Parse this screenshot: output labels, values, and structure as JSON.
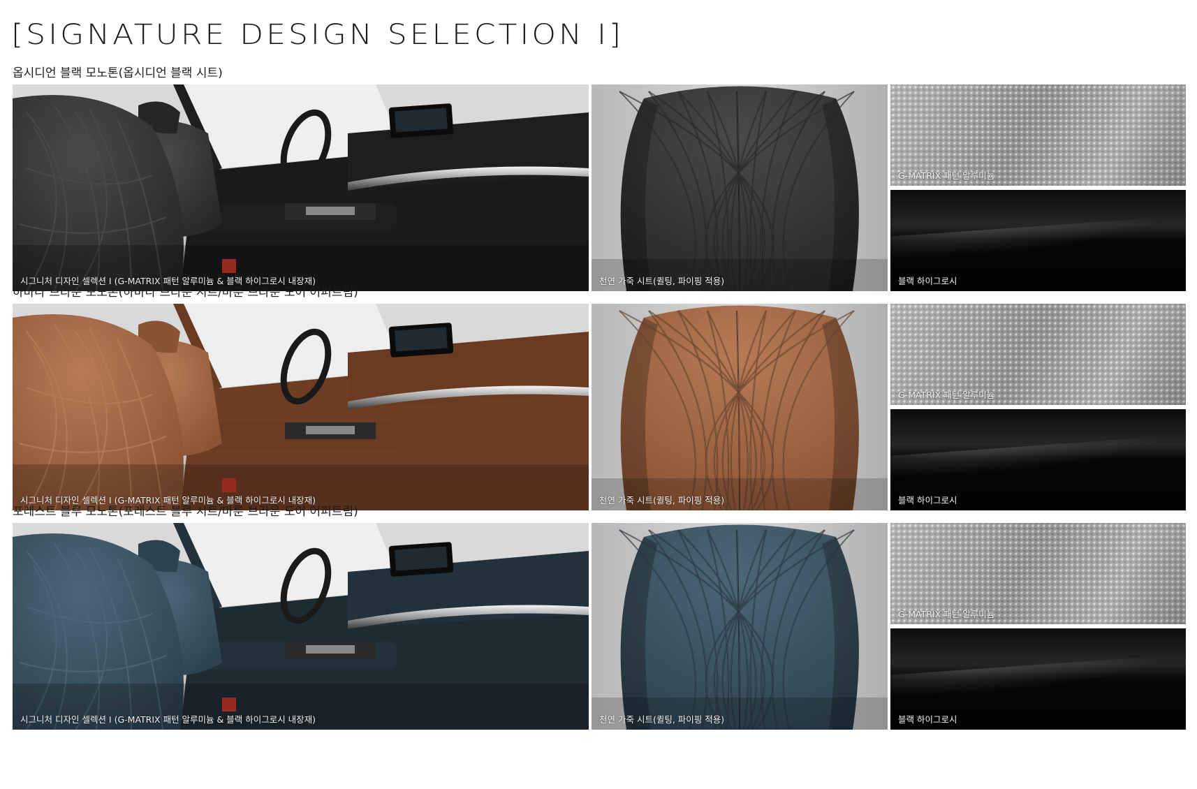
{
  "page_title": "[SIGNATURE DESIGN SELECTION I]",
  "captions": {
    "interior": "시그니처 디자인 셀렉션 I (G-MATRIX 패턴 알루미늄 & 블랙 하이그로시 내장재)",
    "seat": "천연 가죽 시트(퀼팅, 파이핑 적용)",
    "aluminum": "G-MATRIX 패턴 알루미늄",
    "gloss": "블랙 하이그로시"
  },
  "sections": [
    {
      "title": "옵시디언 블랙 모노톤(옵시디언 블랙 시트)",
      "leather_color": "#262626",
      "leather_highlight": "#4a4a4a",
      "trim_color": "#1e1e1e",
      "dash_color": "#1a1a1a"
    },
    {
      "title": "하바나 브라운 모노톤(하바나 브라운 시트/마룬 브라운 도어 어퍼트림)",
      "leather_color": "#8a5334",
      "leather_highlight": "#b67a55",
      "trim_color": "#6b3a22",
      "dash_color": "#6e3d24"
    },
    {
      "title": "포레스트 블루 모노톤(포레스트 블루 시트/마룬 브라운 도어 어퍼트림)",
      "leather_color": "#2d4250",
      "leather_highlight": "#4d6676",
      "trim_color": "#22323d",
      "dash_color": "#1f2b33"
    }
  ]
}
